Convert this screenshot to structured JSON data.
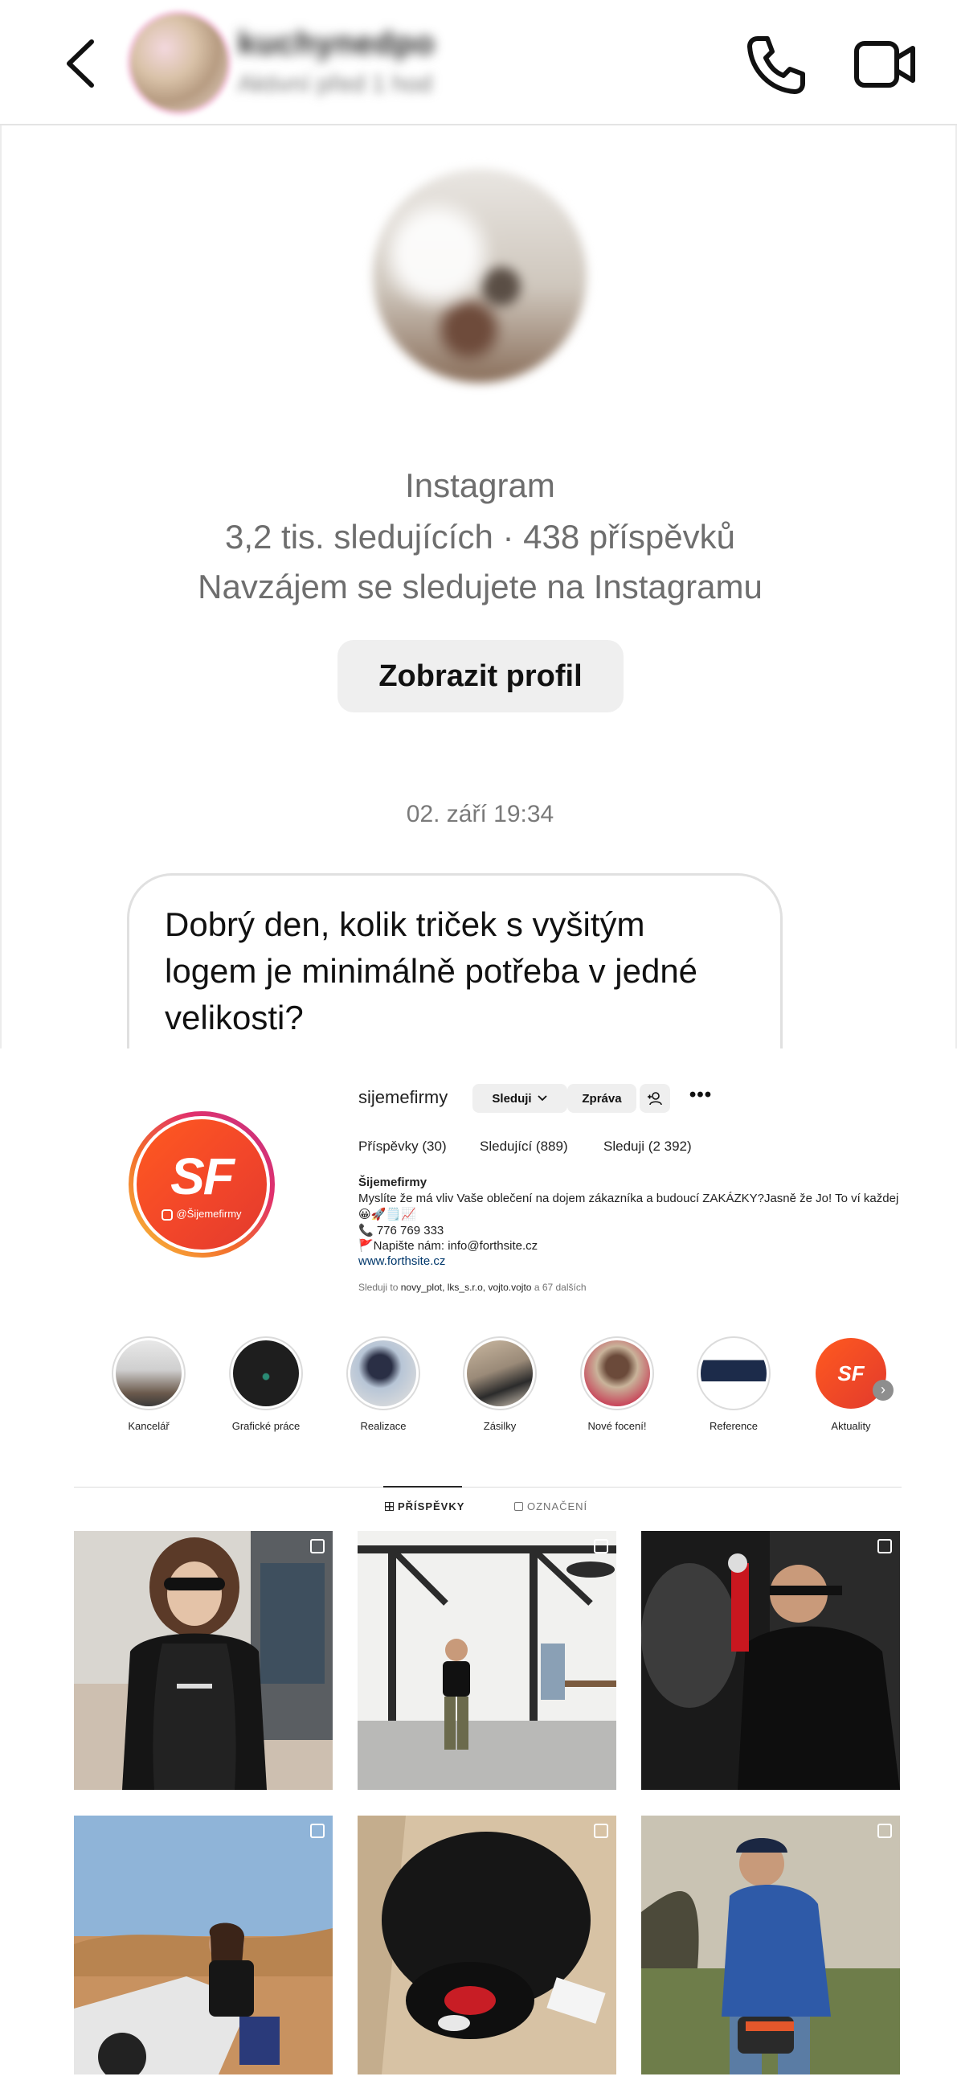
{
  "header": {
    "contact_name": "kuchynedpo",
    "status": "Aktivní před 1 hod"
  },
  "chat": {
    "source": "Instagram",
    "stats": "3,2 tis. sledujících · 438 příspěvků",
    "mutual": "Navzájem se sledujete na Instagramu",
    "view_profile": "Zobrazit profil",
    "timestamp": "02. září 19:34",
    "message": "Dobrý den, kolik triček s vyšitým logem je minimálně potřeba v jedné velikosti?"
  },
  "ig": {
    "username": "sijemefirmy",
    "follow_button": "Sleduji",
    "message_button": "Zpráva",
    "avatar_logo": "SF",
    "avatar_handle": "@Šijemefirmy",
    "stats": [
      {
        "label": "Příspěvky",
        "value": "30"
      },
      {
        "label": "Sledující",
        "value": "889"
      },
      {
        "label": "Sleduji",
        "value": "2 392"
      }
    ],
    "bio_name": "Šijemefirmy",
    "bio_lines": [
      "Myslíte že má vliv Vaše oblečení na dojem zákazníka a budoucí ZAKÁZKY?Jasně že Jo! To ví každej",
      "😀🚀🗒️📈",
      "📞 776 769 333",
      "🚩Napište nám: info@forthsite.cz"
    ],
    "bio_link": "www.forthsite.cz",
    "followed_by_prefix": "Sleduji to",
    "followed_by_names": "novy_plot, lks_s.r.o, vojto.vojto",
    "followed_by_suffix": "a 67 dalších",
    "highlights": [
      {
        "label": "Kancelář"
      },
      {
        "label": "Grafické práce"
      },
      {
        "label": "Realizace"
      },
      {
        "label": "Zásilky"
      },
      {
        "label": "Nové focení!"
      },
      {
        "label": "Reference"
      },
      {
        "label": "Aktuality",
        "badge": "SF"
      }
    ],
    "tabs": [
      {
        "label": "PŘÍSPĚVKY"
      },
      {
        "label": "OZNAČENÍ"
      }
    ]
  },
  "colors": {
    "brand_orange": "#f2462a",
    "button_gray": "#efefef",
    "link_blue": "#00376b"
  }
}
